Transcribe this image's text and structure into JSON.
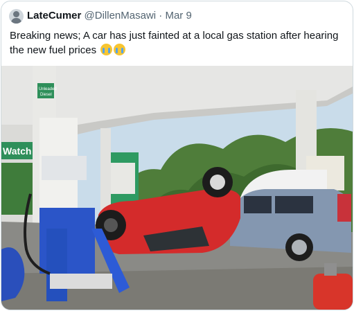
{
  "tweet": {
    "display_name": "LateCumer",
    "handle": "@DillenMasawi",
    "separator": "·",
    "date": "Mar 9",
    "text": "Breaking news; A car has just fainted at a local gas station after hearing the new fuel prices",
    "emojis": [
      "crying-face",
      "crying-face"
    ]
  },
  "photo": {
    "signs": {
      "left_brand": "Watch",
      "pump_label_line1": "Unleaded",
      "pump_label_line2": "Diesel"
    }
  }
}
